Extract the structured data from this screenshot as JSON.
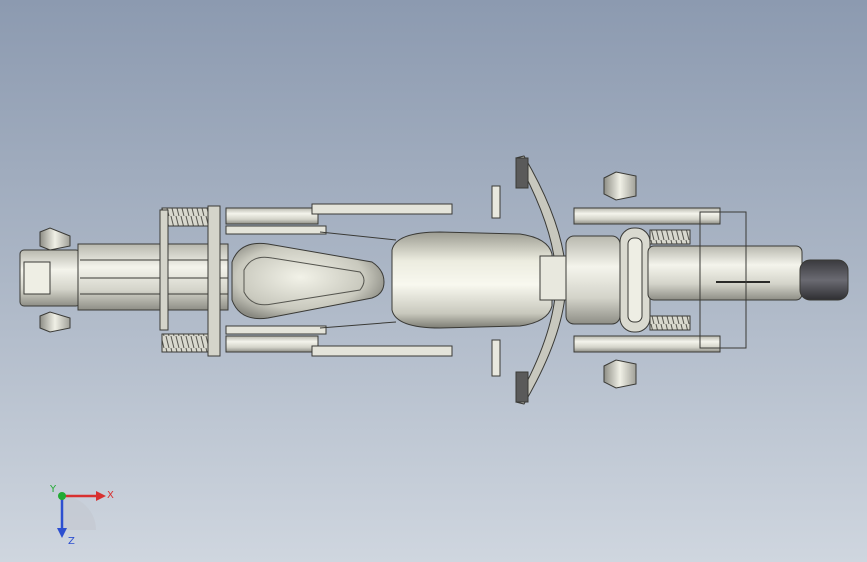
{
  "triad": {
    "x_label": "X",
    "y_label": "Y",
    "z_label": "Z"
  },
  "colors": {
    "x_axis": "#d83030",
    "y_axis": "#22aa33",
    "z_axis": "#2c4fd0",
    "model_fill": "#dcdcd2",
    "model_edge": "#3a3a36"
  }
}
